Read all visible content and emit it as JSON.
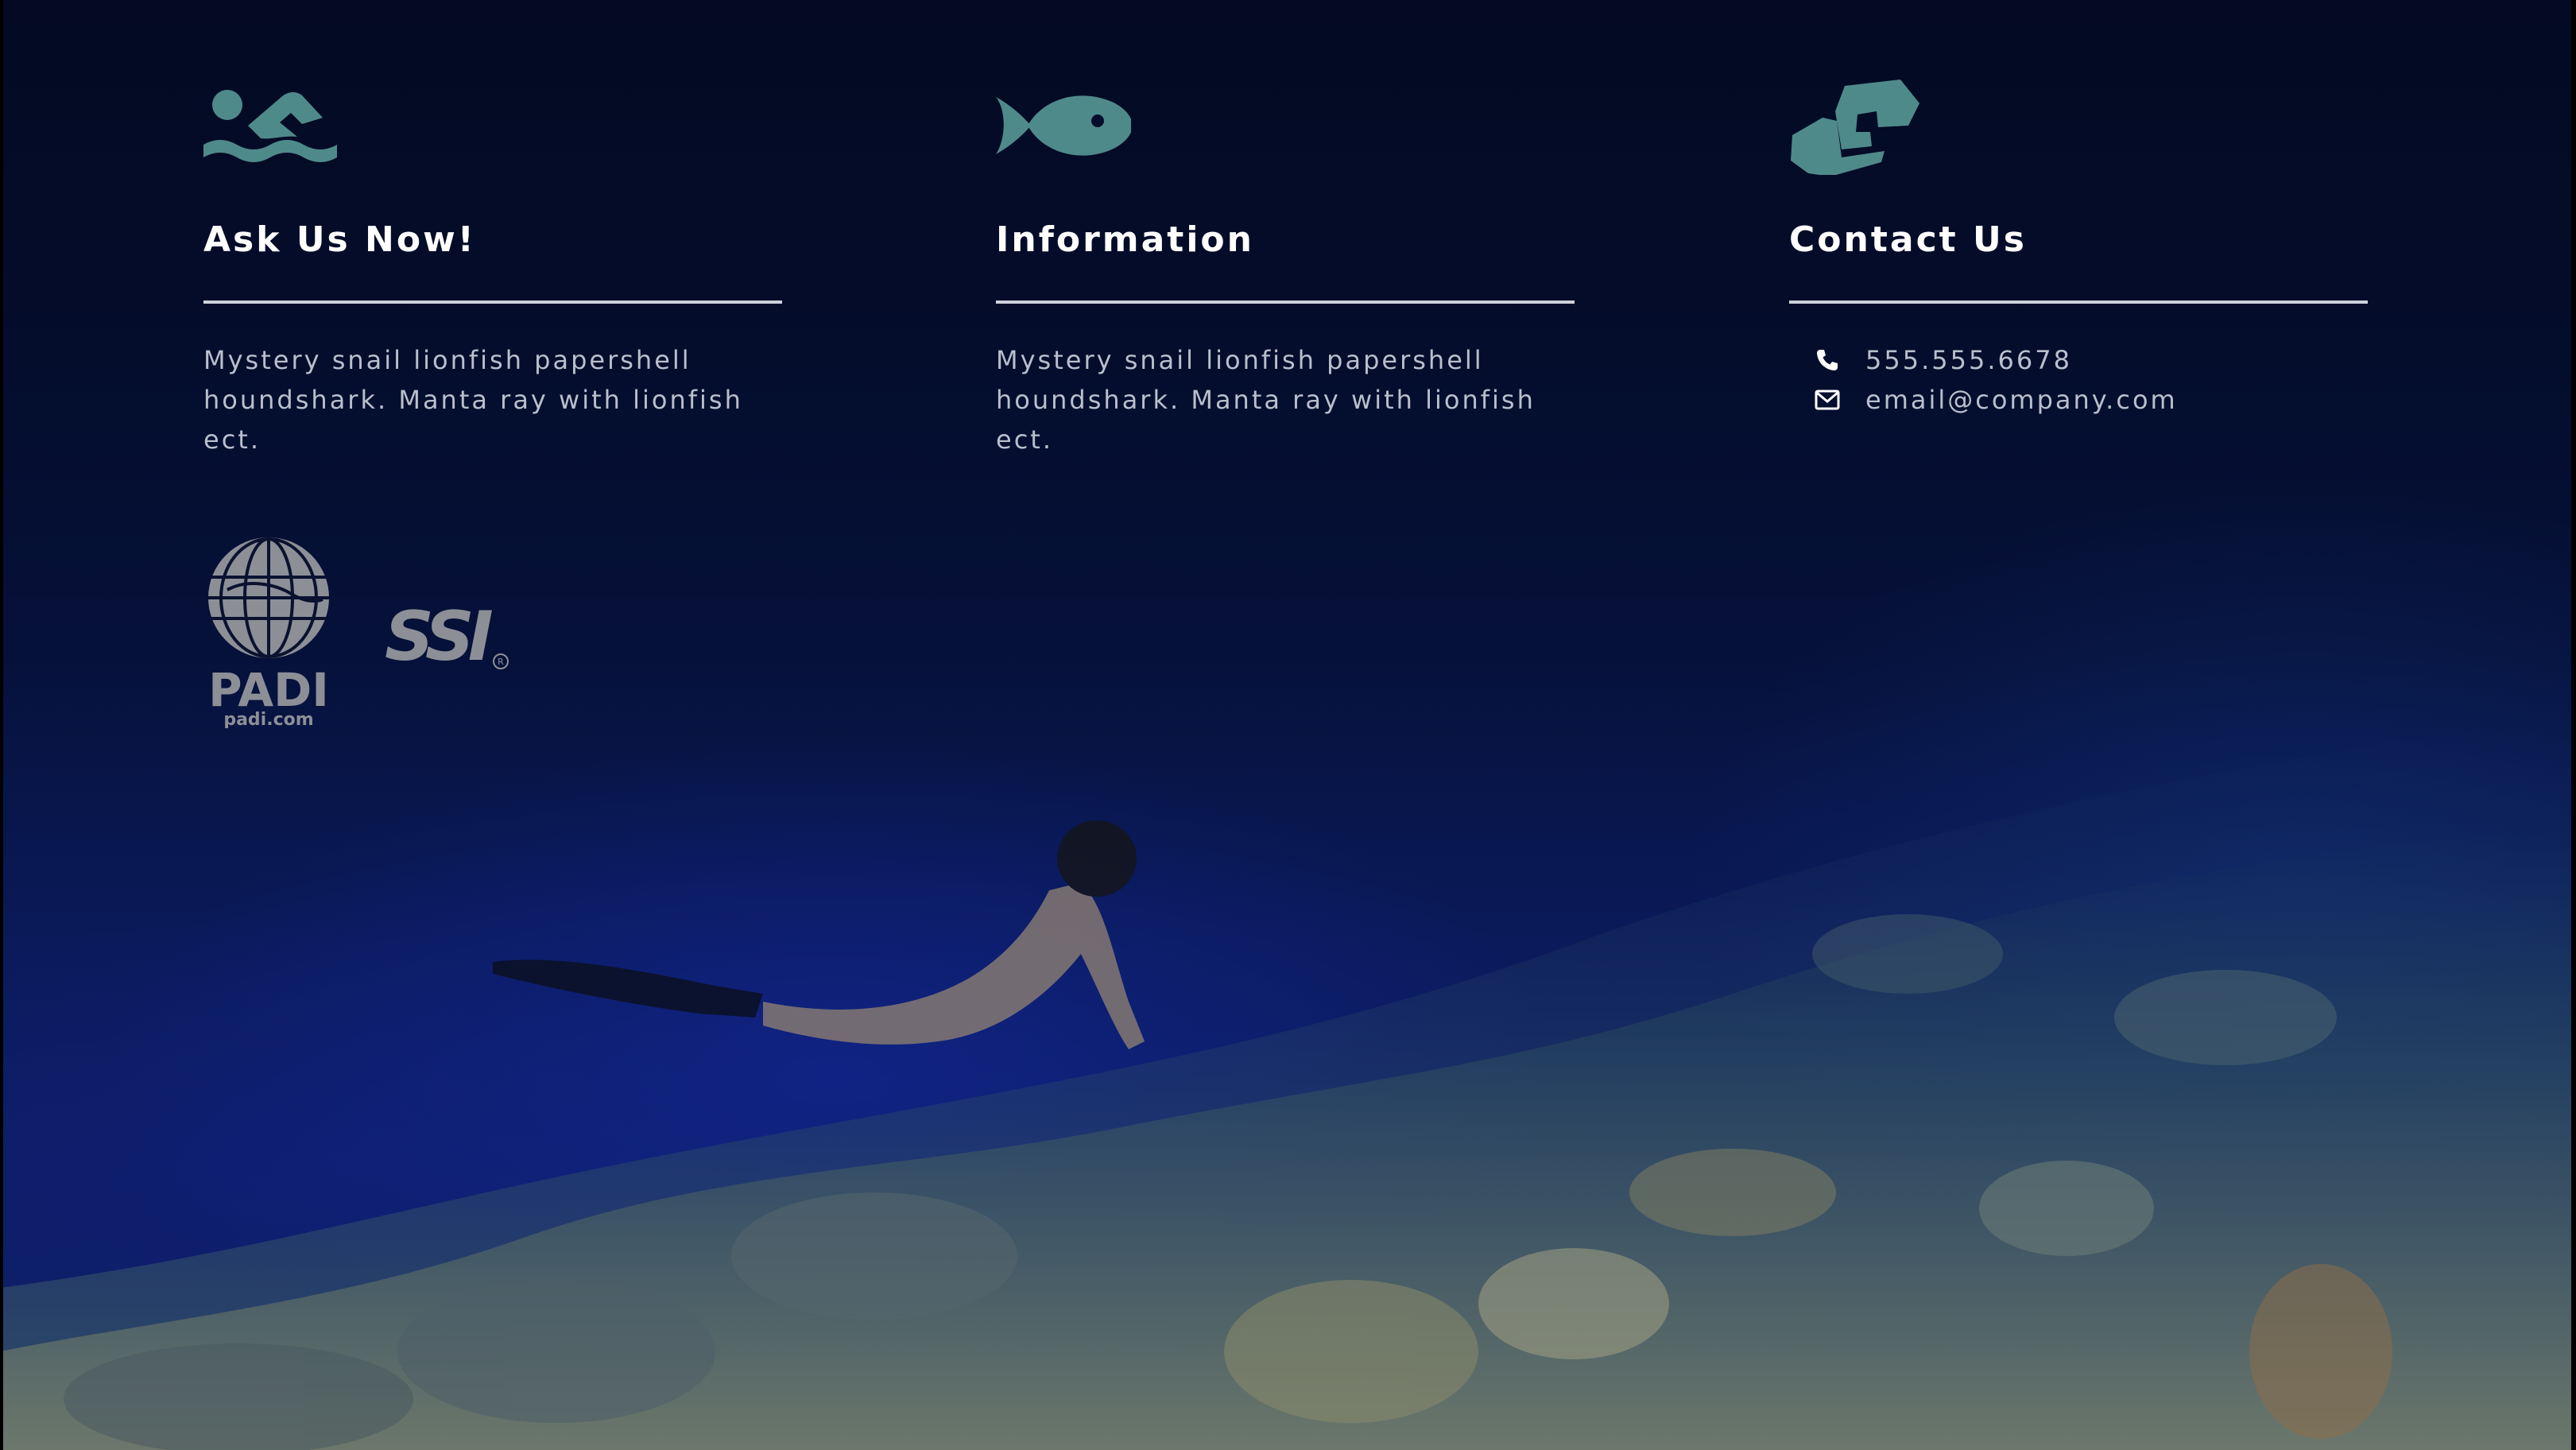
{
  "columns": [
    {
      "icon": "swimmer-icon",
      "title": "Ask Us Now!",
      "text": "Mystery snail lionfish papershell houndshark. Manta ray with lionfish ect."
    },
    {
      "icon": "fish-icon",
      "title": "Information",
      "text": "Mystery snail lionfish papershell houndshark. Manta ray with lionfish ect."
    },
    {
      "icon": "handshake-icon",
      "title": "Contact Us",
      "phone": "555.555.6678",
      "email": "email@company.com"
    }
  ],
  "logos": {
    "padi_wordmark": "PADI",
    "padi_url": "padi.com",
    "ssi_wordmark": "SSI"
  },
  "colors": {
    "icon_teal": "#4f8a8b",
    "heading": "#ffffff",
    "body_text": "#b9bfcc",
    "rule": "#cfd3dc",
    "logo_gray": "#8c8f96"
  }
}
